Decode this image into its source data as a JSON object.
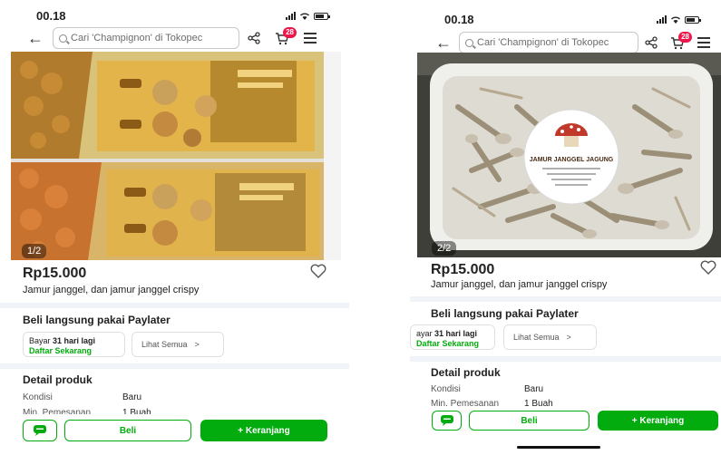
{
  "left": {
    "status": {
      "time": "00.18"
    },
    "search": {
      "placeholder": "Cari 'Champignon' di Tokopec",
      "cart_count": "28"
    },
    "gallery": {
      "counter": "1/2"
    },
    "product": {
      "price": "Rp15.000",
      "title": "Jamur janggel, dan jamur janggel crispy"
    },
    "paylater": {
      "heading": "Beli langsung pakai Paylater",
      "card_line1_prefix": "Bayar ",
      "card_line1_bold": "31 hari lagi",
      "card_line2": "Daftar Sekarang",
      "see_all": "Lihat Semua",
      "see_all_chevron": ">"
    },
    "details": {
      "heading": "Detail produk",
      "rows": [
        {
          "key": "Kondisi",
          "value": "Baru"
        },
        {
          "key": "Min. Pemesanan",
          "value": "1 Buah"
        }
      ]
    },
    "actions": {
      "buy": "Beli",
      "add_cart": "+ Keranjang"
    }
  },
  "right": {
    "status": {
      "time": "00.18"
    },
    "search": {
      "placeholder": "Cari 'Champignon' di Tokopec",
      "cart_count": "28"
    },
    "gallery": {
      "counter": "2/2",
      "sticker_text": "JAMUR JANGGEL JAGUNG"
    },
    "product": {
      "price": "Rp15.000",
      "title": "Jamur janggel, dan jamur janggel crispy"
    },
    "paylater": {
      "heading": "Beli langsung pakai Paylater",
      "card_line1_prefix": "ayar ",
      "card_line1_bold": "31 hari lagi",
      "card_line2": "Daftar Sekarang",
      "see_all": "Lihat Semua",
      "see_all_chevron": ">"
    },
    "details": {
      "heading": "Detail produk",
      "rows": [
        {
          "key": "Kondisi",
          "value": "Baru"
        },
        {
          "key": "Min. Pemesanan",
          "value": "1 Buah"
        }
      ]
    },
    "actions": {
      "buy": "Beli",
      "add_cart": "+ Keranjang"
    }
  },
  "colors": {
    "accent_green": "#03ac0e",
    "badge_red": "#ef144a",
    "divider": "#f0f3f7"
  },
  "icons": [
    "back-arrow-icon",
    "search-icon",
    "share-icon",
    "cart-icon",
    "menu-icon",
    "heart-icon",
    "chat-icon",
    "signal-icon",
    "wifi-icon",
    "battery-icon"
  ]
}
